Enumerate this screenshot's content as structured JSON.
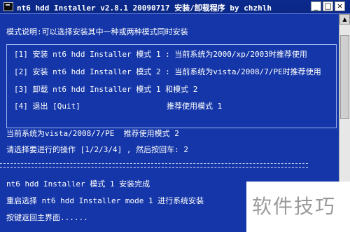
{
  "window": {
    "title": "nt6 hdd Installer v2.8.1 20090717 安装/卸载程序 by chzhlh",
    "min_glyph": "_",
    "max_glyph": "□",
    "close_glyph": "×"
  },
  "console": {
    "mode_desc": "模式说明:可以选择安装其中一种或两种模式同时安装",
    "menu": [
      "[1] 安装 nt6 hdd Installer 模式 1 : 当前系统为2000/xp/2003时推荐使用",
      "[2] 安装 nt6 hdd Installer 模式 2 : 当前系统为vista/2008/7/PE时推荐使用",
      "[3] 卸载 nt6 hdd Installer 模式 1 和模式 2",
      "[4] 退出 [Quit]"
    ],
    "menu_4_note": "推荐使用模式 1",
    "current_system": "当前系统为vista/2008/7/PE  推荐使用模式 2",
    "prompt": "请选择要进行的操作 [1/2/3/4] , 然后按回车: 2",
    "install_done": "nt6 hdd Installer 模式 1 安装完成",
    "reboot_msg": "重启选择 nt6 hdd Installer mode 1 进行系统安装",
    "return_msg": "按键返回主界面......"
  },
  "watermark": {
    "text": "软件技巧"
  },
  "colors": {
    "console_bg": "#1436a8",
    "titlebar_bg": "#0b2a8c",
    "text": "#ffffff"
  }
}
